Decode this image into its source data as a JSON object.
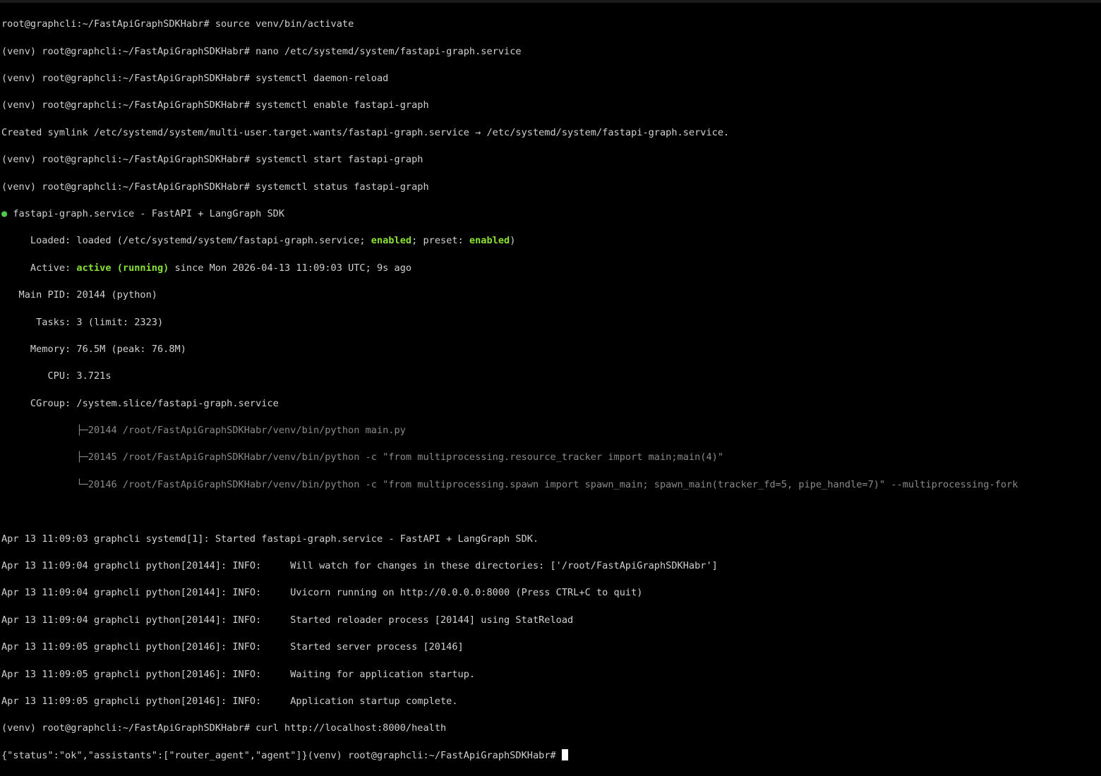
{
  "terminal": {
    "prompt_root": "root@graphcli:~/FastApiGraphSDKHabr# ",
    "prompt_venv": "(venv) root@graphcli:~/FastApiGraphSDKHabr# ",
    "commands": {
      "activate": "source venv/bin/activate",
      "nano": "nano /etc/systemd/system/fastapi-graph.service",
      "reload": "systemctl daemon-reload",
      "enable": "systemctl enable fastapi-graph",
      "start": "systemctl start fastapi-graph",
      "status": "systemctl status fastapi-graph",
      "curl": "curl http://localhost:8000/health"
    },
    "symlink_output": "Created symlink /etc/systemd/system/multi-user.target.wants/fastapi-graph.service → /etc/systemd/system/fastapi-graph.service.",
    "status": {
      "dot": "●",
      "header": " fastapi-graph.service - FastAPI + LangGraph SDK",
      "loaded_prefix": "     Loaded: loaded (/etc/systemd/system/fastapi-graph.service; ",
      "loaded_enabled": "enabled",
      "loaded_mid": "; preset: ",
      "loaded_preset": "enabled",
      "loaded_suffix": ")",
      "active_prefix": "     Active: ",
      "active_state": "active (running)",
      "active_suffix": " since Mon 2026-04-13 11:09:03 UTC; 9s ago",
      "main_pid": "   Main PID: 20144 (python)",
      "tasks": "      Tasks: 3 (limit: 2323)",
      "memory": "     Memory: 76.5M (peak: 76.8M)",
      "cpu": "        CPU: 3.721s",
      "cgroup": "     CGroup: /system.slice/fastapi-graph.service",
      "cgroup_tree": [
        "             ├─20144 /root/FastApiGraphSDKHabr/venv/bin/python main.py",
        "             ├─20145 /root/FastApiGraphSDKHabr/venv/bin/python -c \"from multiprocessing.resource_tracker import main;main(4)\"",
        "             └─20146 /root/FastApiGraphSDKHabr/venv/bin/python -c \"from multiprocessing.spawn import spawn_main; spawn_main(tracker_fd=5, pipe_handle=7)\" --multiprocessing-fork"
      ]
    },
    "journal": [
      "Apr 13 11:09:03 graphcli systemd[1]: Started fastapi-graph.service - FastAPI + LangGraph SDK.",
      "Apr 13 11:09:04 graphcli python[20144]: INFO:     Will watch for changes in these directories: ['/root/FastApiGraphSDKHabr']",
      "Apr 13 11:09:04 graphcli python[20144]: INFO:     Uvicorn running on http://0.0.0.0:8000 (Press CTRL+C to quit)",
      "Apr 13 11:09:04 graphcli python[20144]: INFO:     Started reloader process [20144] using StatReload",
      "Apr 13 11:09:05 graphcli python[20146]: INFO:     Started server process [20146]",
      "Apr 13 11:09:05 graphcli python[20146]: INFO:     Waiting for application startup.",
      "Apr 13 11:09:05 graphcli python[20146]: INFO:     Application startup complete."
    ],
    "curl_output": "{\"status\":\"ok\",\"assistants\":[\"router_agent\",\"agent\"]}",
    "colors": {
      "background": "#000000",
      "text": "#d0d0d0",
      "highlight_green": "#8ae234",
      "status_dot": "#4ec94e",
      "dim_text": "#8a8a8a",
      "cursor": "#ffffff"
    }
  }
}
